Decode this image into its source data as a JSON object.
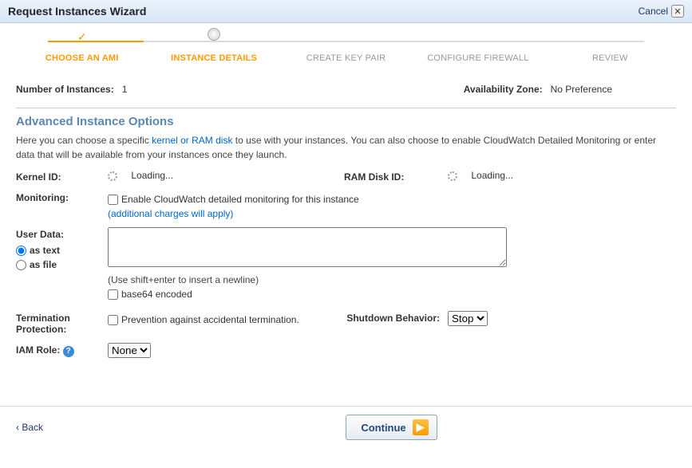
{
  "header": {
    "title": "Request Instances Wizard",
    "cancel": "Cancel"
  },
  "steps": [
    {
      "label": "CHOOSE AN AMI",
      "state": "done"
    },
    {
      "label": "INSTANCE DETAILS",
      "state": "current"
    },
    {
      "label": "CREATE KEY PAIR",
      "state": "pending"
    },
    {
      "label": "CONFIGURE FIREWALL",
      "state": "pending"
    },
    {
      "label": "REVIEW",
      "state": "pending"
    }
  ],
  "summary": {
    "numInstancesLabel": "Number of Instances:",
    "numInstances": "1",
    "azLabel": "Availability Zone:",
    "az": "No Preference"
  },
  "sectionTitle": "Advanced Instance Options",
  "intro": {
    "pre": "Here you can choose a specific ",
    "link": "kernel or RAM disk",
    "post": " to use with your instances. You can also choose to enable CloudWatch Detailed Monitoring or enter data that will be available from your instances once they launch."
  },
  "kernel": {
    "label": "Kernel ID:",
    "loading": "Loading..."
  },
  "ramdisk": {
    "label": "RAM Disk ID:",
    "loading": "Loading..."
  },
  "monitoring": {
    "label": "Monitoring:",
    "cbLabel": "Enable CloudWatch detailed monitoring for this instance",
    "chargesLink": "(additional charges will apply)"
  },
  "userdata": {
    "label": "User Data:",
    "asText": "as text",
    "asFile": "as file",
    "hint": "(Use shift+enter to insert a newline)",
    "base64": "base64 encoded"
  },
  "termination": {
    "label": "Termination Protection:",
    "cbLabel": "Prevention against accidental termination."
  },
  "shutdown": {
    "label": "Shutdown Behavior:",
    "value": "Stop"
  },
  "iam": {
    "label": "IAM Role:",
    "value": "None"
  },
  "footer": {
    "back": "Back",
    "continue": "Continue"
  }
}
